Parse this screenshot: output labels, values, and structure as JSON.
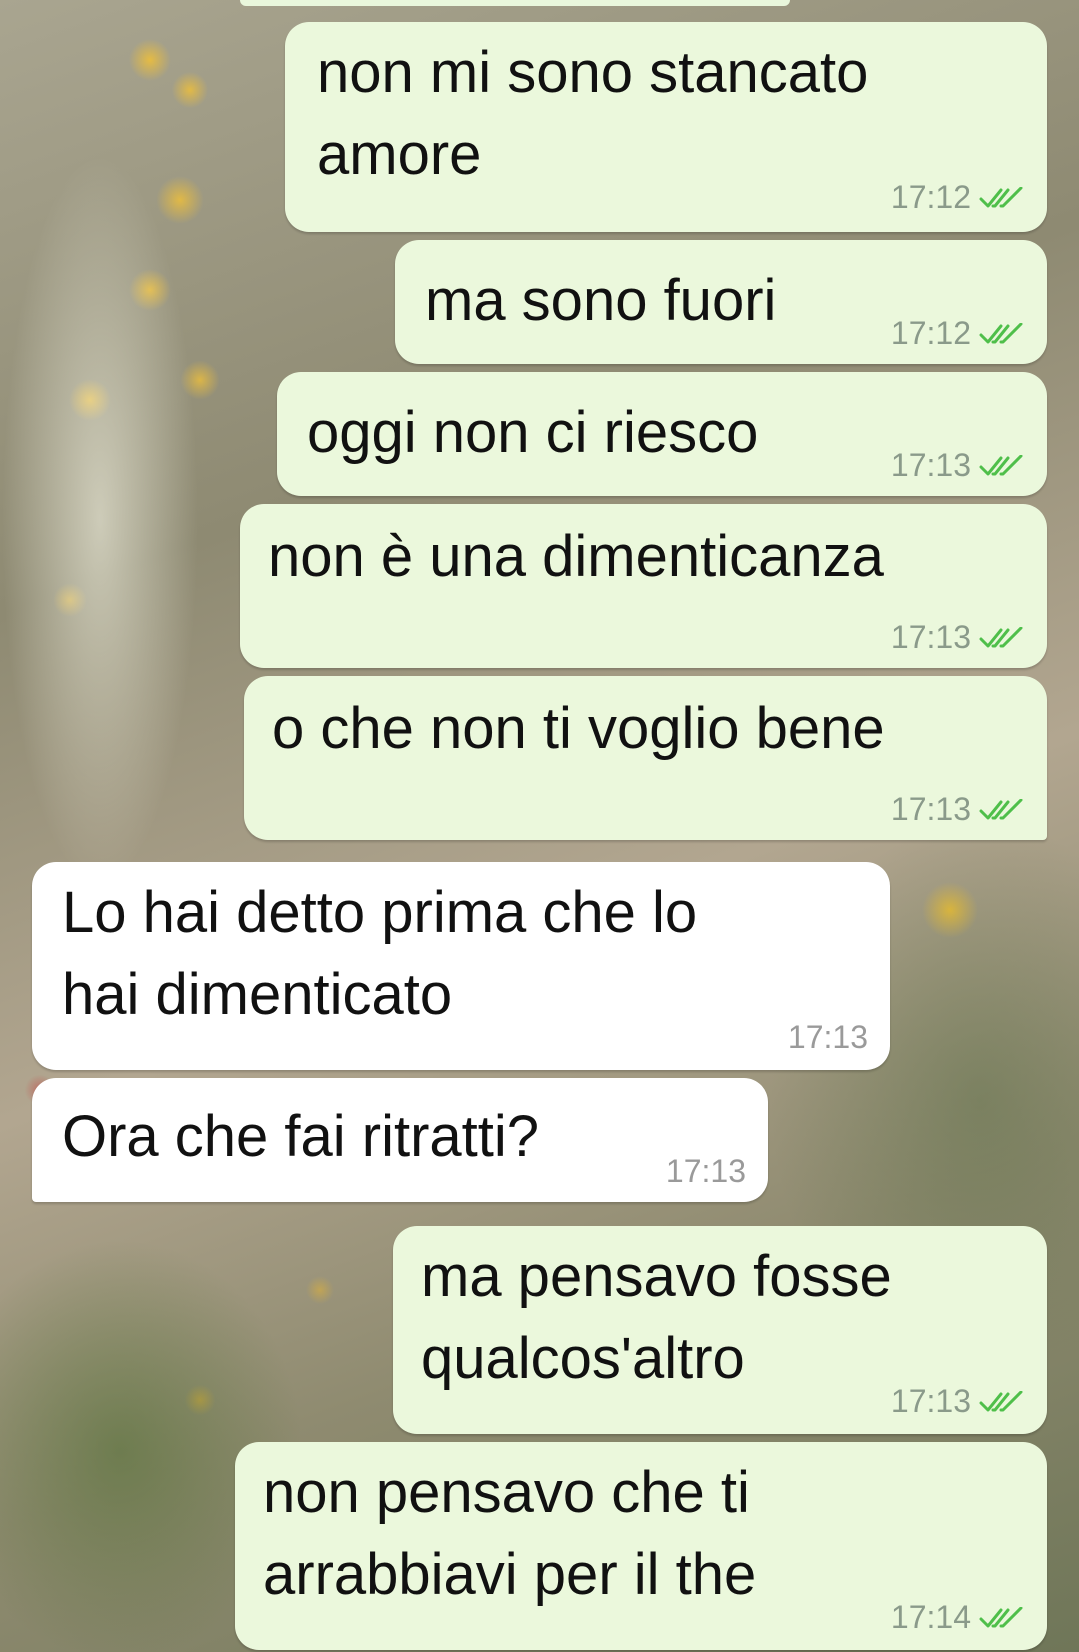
{
  "messages": [
    {
      "direction": "out",
      "text": "non mi sono stancato\namore",
      "time": "17:12",
      "status_icon": "double-check-icon"
    },
    {
      "direction": "out",
      "text": "ma sono fuori",
      "time": "17:12",
      "status_icon": "double-check-icon"
    },
    {
      "direction": "out",
      "text": "oggi non ci riesco",
      "time": "17:13",
      "status_icon": "double-check-icon"
    },
    {
      "direction": "out",
      "text": "non è una dimenticanza",
      "time": "17:13",
      "status_icon": "double-check-icon"
    },
    {
      "direction": "out",
      "text": "o che non ti voglio bene",
      "time": "17:13",
      "status_icon": "double-check-icon"
    },
    {
      "direction": "in",
      "text": "Lo hai detto prima che lo\nhai dimenticato",
      "time": "17:13"
    },
    {
      "direction": "in",
      "text": "Ora che fai ritratti?",
      "time": "17:13"
    },
    {
      "direction": "out",
      "text": "ma pensavo fosse\nqualcos'altro",
      "time": "17:13",
      "status_icon": "double-check-icon"
    },
    {
      "direction": "out",
      "text": "non pensavo che ti\narrabbiavi per il the",
      "time": "17:14",
      "status_icon": "double-check-icon"
    }
  ],
  "colors": {
    "outgoing_bubble": "#ebf8dc",
    "incoming_bubble": "#ffffff",
    "read_ticks": "#4fbf4a"
  }
}
